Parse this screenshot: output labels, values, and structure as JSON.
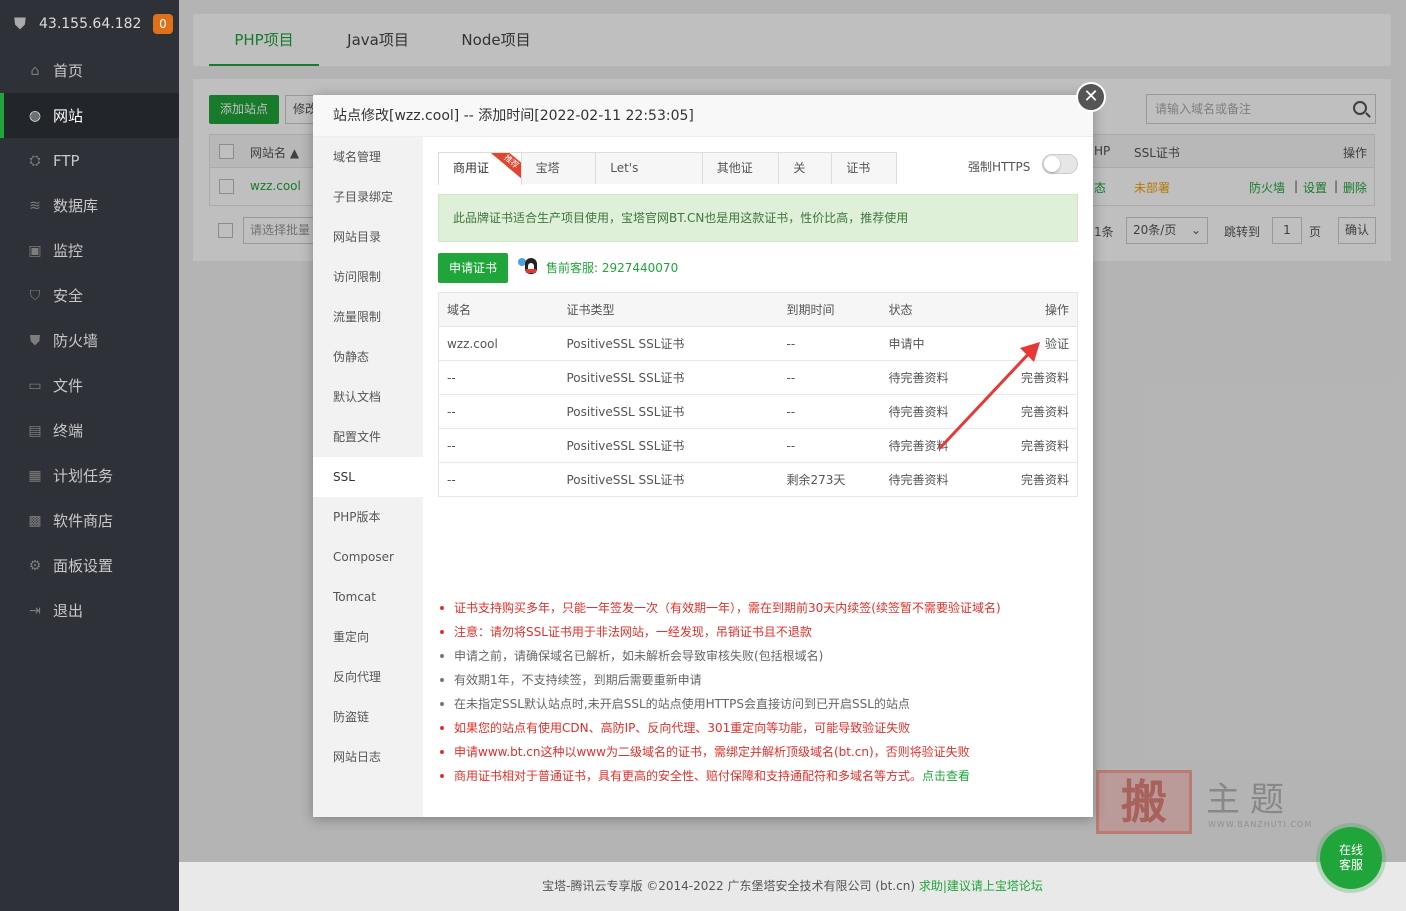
{
  "server": {
    "ip": "43.155.64.182",
    "badge": "0"
  },
  "nav": [
    {
      "label": "首页",
      "icon": "home-icon",
      "glyph": "⌂"
    },
    {
      "label": "网站",
      "icon": "globe-icon",
      "glyph": "◍",
      "active": true
    },
    {
      "label": "FTP",
      "icon": "ftp-icon",
      "glyph": "⛭"
    },
    {
      "label": "数据库",
      "icon": "database-icon",
      "glyph": "≋"
    },
    {
      "label": "监控",
      "icon": "monitor-icon",
      "glyph": "▣"
    },
    {
      "label": "安全",
      "icon": "shield-icon",
      "glyph": "⛉"
    },
    {
      "label": "防火墙",
      "icon": "firewall-icon",
      "glyph": "⛊"
    },
    {
      "label": "文件",
      "icon": "folder-icon",
      "glyph": "▭"
    },
    {
      "label": "终端",
      "icon": "terminal-icon",
      "glyph": "▤"
    },
    {
      "label": "计划任务",
      "icon": "calendar-icon",
      "glyph": "▦"
    },
    {
      "label": "软件商店",
      "icon": "apps-icon",
      "glyph": "▩"
    },
    {
      "label": "面板设置",
      "icon": "gear-icon",
      "glyph": "⚙"
    },
    {
      "label": "退出",
      "icon": "logout-icon",
      "glyph": "⇥"
    }
  ],
  "top_tabs": [
    "PHP项目",
    "Java项目",
    "Node项目"
  ],
  "toolbar": {
    "add_site": "添加站点",
    "modify": "修改",
    "search_placeholder": "请输入域名或备注"
  },
  "site_table": {
    "headers": {
      "name": "网站名 ▲",
      "php": "HP",
      "ssl": "SSL证书",
      "ops": "操作"
    },
    "row": {
      "name": "wzz.cool",
      "status": "态",
      "ssl": "未部署",
      "firewall": "防火墙",
      "settings": "设置",
      "delete": "删除"
    },
    "batch_placeholder": "请选择批量",
    "pager": {
      "total": "1条",
      "per_page": "20条/页",
      "jump": "跳转到",
      "page": "1",
      "page_unit": "页",
      "confirm": "确认"
    }
  },
  "modal": {
    "title": "站点修改[wzz.cool] -- 添加时间[2022-02-11 22:53:05]",
    "close": "✕",
    "side": [
      "域名管理",
      "子目录绑定",
      "网站目录",
      "访问限制",
      "流量限制",
      "伪静态",
      "默认文档",
      "配置文件",
      "SSL",
      "PHP版本",
      "Composer",
      "Tomcat",
      "重定向",
      "反向代理",
      "防盗链",
      "网站日志"
    ],
    "side_active": "SSL",
    "ssl_tabs": [
      "商用证书",
      "宝塔SSL",
      "Let's Encrypt",
      "其他证书",
      "关闭",
      "证书夹"
    ],
    "ribbon": "推荐",
    "force_https": "强制HTTPS",
    "notice": "此品牌证书适合生产项目使用，宝塔官网BT.CN也是用这款证书，性价比高，推荐使用",
    "apply_button": "申请证书",
    "support": "售前客服: 2927440070",
    "cert_headers": [
      "域名",
      "证书类型",
      "到期时间",
      "状态",
      "操作"
    ],
    "cert_rows": [
      {
        "domain": "wzz.cool",
        "type": "PositiveSSL SSL证书",
        "expire": "--",
        "status": "申请中",
        "action": "验证"
      },
      {
        "domain": "--",
        "type": "PositiveSSL SSL证书",
        "expire": "--",
        "status": "待完善资料",
        "action": "完善资料"
      },
      {
        "domain": "--",
        "type": "PositiveSSL SSL证书",
        "expire": "--",
        "status": "待完善资料",
        "action": "完善资料"
      },
      {
        "domain": "--",
        "type": "PositiveSSL SSL证书",
        "expire": "--",
        "status": "待完善资料",
        "action": "完善资料"
      },
      {
        "domain": "--",
        "type": "PositiveSSL SSL证书",
        "expire": "剩余273天",
        "status": "待完善资料",
        "action": "完善资料"
      }
    ],
    "notes": [
      {
        "text": "证书支持购买多年，只能一年签发一次（有效期一年），需在到期前30天内续签(续签暂不需要验证域名)",
        "red": true
      },
      {
        "text": "注意：请勿将SSL证书用于非法网站，一经发现，吊销证书且不退款",
        "red": true
      },
      {
        "text": "申请之前，请确保域名已解析，如未解析会导致审核失败(包括根域名)",
        "red": false
      },
      {
        "text": "有效期1年，不支持续签，到期后需要重新申请",
        "red": false
      },
      {
        "text": "在未指定SSL默认站点时,未开启SSL的站点使用HTTPS会直接访问到已开启SSL的站点",
        "red": false
      },
      {
        "text": "如果您的站点有使用CDN、高防IP、反向代理、301重定向等功能，可能导致验证失败",
        "red": true
      },
      {
        "text": "申请www.bt.cn这种以www为二级域名的证书，需绑定并解析顶级域名(bt.cn)，否则将验证失败",
        "red": true
      },
      {
        "text": "商用证书相对于普通证书，具有更高的安全性、赔付保障和支持通配符和多域名等方式。",
        "red": true,
        "link": "点击查看"
      }
    ]
  },
  "footer": {
    "text": "宝塔-腾讯云专享版 ©2014-2022 广东堡塔安全技术有限公司 (bt.cn)",
    "link": "求助|建议请上宝塔论坛"
  },
  "watermark": {
    "stamp": "搬",
    "text": "主题",
    "url": "WWW.BANZHUTI.COM"
  },
  "online_service": {
    "line1": "在线",
    "line2": "客服"
  },
  "colors": {
    "brand_green": "#20a53a",
    "sidebar_bg": "#2e3138",
    "warning_orange": "#f0a30a",
    "note_red": "#e0302a"
  }
}
